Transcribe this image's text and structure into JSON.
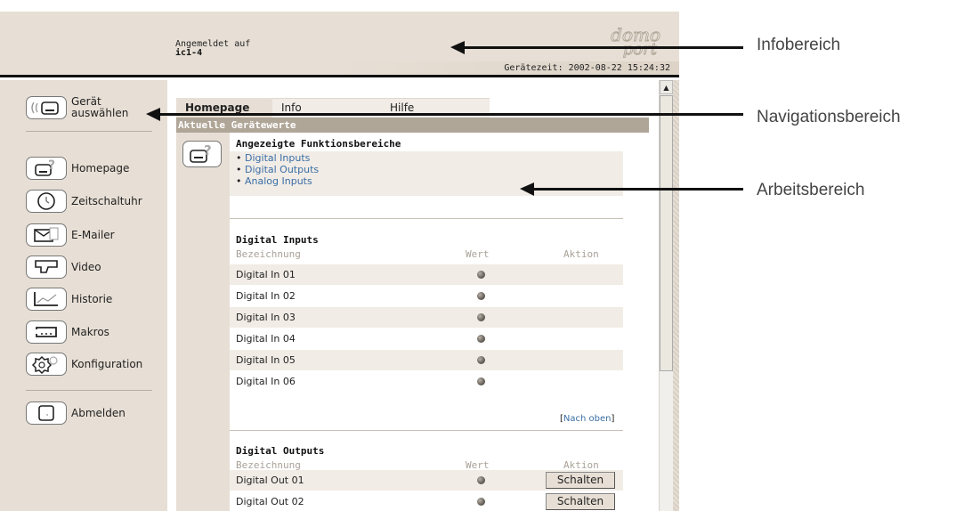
{
  "header": {
    "login_label": "Angemeldet auf",
    "login_host": "ic1-4",
    "logo_line1": "domo",
    "logo_line2": "port",
    "device_time": "Gerätezeit: 2002-08-22 15:24:32"
  },
  "sidebar": {
    "select_device": [
      "Gerät",
      "auswählen"
    ],
    "items": [
      {
        "label": "Homepage",
        "icon": "help-device-icon"
      },
      {
        "label": "Zeitschaltuhr",
        "icon": "clock-icon"
      },
      {
        "label": "E-Mailer",
        "icon": "envelope-icon"
      },
      {
        "label": "Video",
        "icon": "camera-icon"
      },
      {
        "label": "Historie",
        "icon": "chart-icon"
      },
      {
        "label": "Makros",
        "icon": "macro-icon"
      },
      {
        "label": "Konfiguration",
        "icon": "gear-icon"
      }
    ],
    "logout": "Abmelden"
  },
  "tabs": [
    {
      "label": "Homepage",
      "active": true
    },
    {
      "label": "Info",
      "active": false
    },
    {
      "label": "Hilfe",
      "active": false
    }
  ],
  "section_title": "Aktuelle Gerätewerte",
  "functions": {
    "title": "Angezeigte Funktionsbereiche",
    "links": [
      "Digital Inputs",
      "Digital Outputs",
      "Analog Inputs"
    ]
  },
  "digital_inputs": {
    "title": "Digital Inputs",
    "columns": [
      "Bezeichnung",
      "Wert",
      "Aktion"
    ],
    "rows": [
      "Digital In 01",
      "Digital In 02",
      "Digital In 03",
      "Digital In 04",
      "Digital In 05",
      "Digital In 06"
    ],
    "back_top": "Nach oben"
  },
  "digital_outputs": {
    "title": "Digital Outputs",
    "columns": [
      "Bezeichnung",
      "Wert",
      "Aktion"
    ],
    "rows": [
      {
        "name": "Digital Out 01",
        "action": "Schalten"
      },
      {
        "name": "Digital Out 02",
        "action": "Schalten"
      }
    ]
  },
  "annotations": {
    "info": "Infobereich",
    "nav": "Navigationsbereich",
    "work": "Arbeitsbereich"
  },
  "colors": {
    "panel": "#e7dfd5",
    "section_bar": "#b0a698",
    "link": "#3a6ea5"
  }
}
